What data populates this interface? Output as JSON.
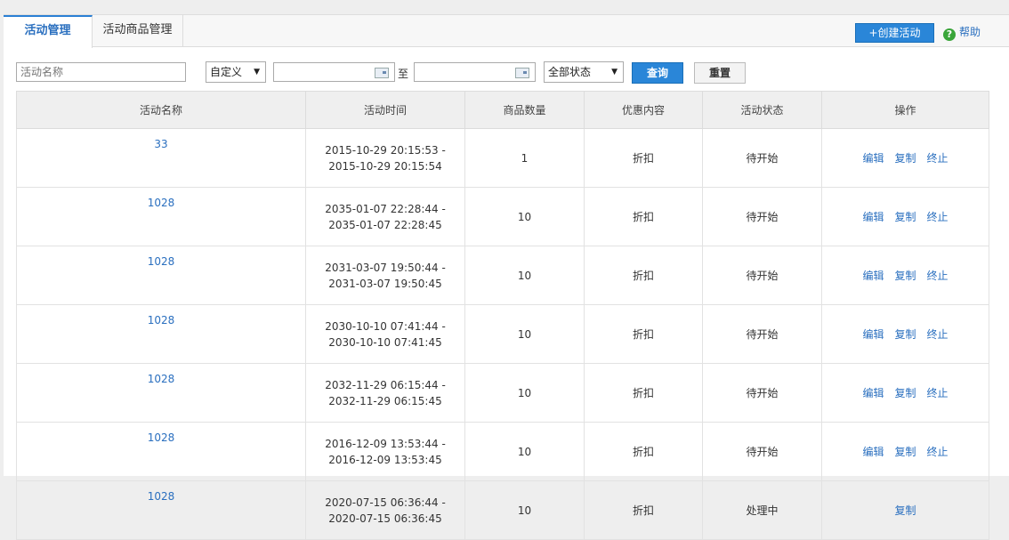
{
  "tabs": [
    "活动管理",
    "活动商品管理"
  ],
  "create_button": "+创建活动",
  "help_label": "帮助",
  "filters": {
    "name_placeholder": "活动名称",
    "time_mode": "自定义",
    "date_separator": "至",
    "status": "全部状态",
    "query_label": "查询",
    "reset_label": "重置"
  },
  "table": {
    "headers": [
      "活动名称",
      "活动时间",
      "商品数量",
      "优惠内容",
      "活动状态",
      "操作"
    ],
    "rows": [
      {
        "name": "33",
        "start": "2015-10-29 20:15:53 -",
        "end": "2015-10-29 20:15:54",
        "count": "1",
        "discount": "折扣",
        "status": "待开始",
        "ops": [
          "编辑",
          "复制",
          "终止"
        ]
      },
      {
        "name": "1028",
        "start": "2035-01-07 22:28:44 -",
        "end": "2035-01-07 22:28:45",
        "count": "10",
        "discount": "折扣",
        "status": "待开始",
        "ops": [
          "编辑",
          "复制",
          "终止"
        ]
      },
      {
        "name": "1028",
        "start": "2031-03-07 19:50:44 -",
        "end": "2031-03-07 19:50:45",
        "count": "10",
        "discount": "折扣",
        "status": "待开始",
        "ops": [
          "编辑",
          "复制",
          "终止"
        ]
      },
      {
        "name": "1028",
        "start": "2030-10-10 07:41:44 -",
        "end": "2030-10-10 07:41:45",
        "count": "10",
        "discount": "折扣",
        "status": "待开始",
        "ops": [
          "编辑",
          "复制",
          "终止"
        ]
      },
      {
        "name": "1028",
        "start": "2032-11-29 06:15:44 -",
        "end": "2032-11-29 06:15:45",
        "count": "10",
        "discount": "折扣",
        "status": "待开始",
        "ops": [
          "编辑",
          "复制",
          "终止"
        ]
      },
      {
        "name": "1028",
        "start": "2016-12-09 13:53:44 -",
        "end": "2016-12-09 13:53:45",
        "count": "10",
        "discount": "折扣",
        "status": "待开始",
        "ops": [
          "编辑",
          "复制",
          "终止"
        ]
      },
      {
        "name": "1028",
        "start": "2020-07-15 06:36:44 -",
        "end": "2020-07-15 06:36:45",
        "count": "10",
        "discount": "折扣",
        "status": "处理中",
        "ops": [
          "复制"
        ]
      }
    ]
  },
  "colors": {
    "accent": "#2a86d8",
    "link": "#2a6fbf",
    "help_icon": "#3aa53a"
  }
}
